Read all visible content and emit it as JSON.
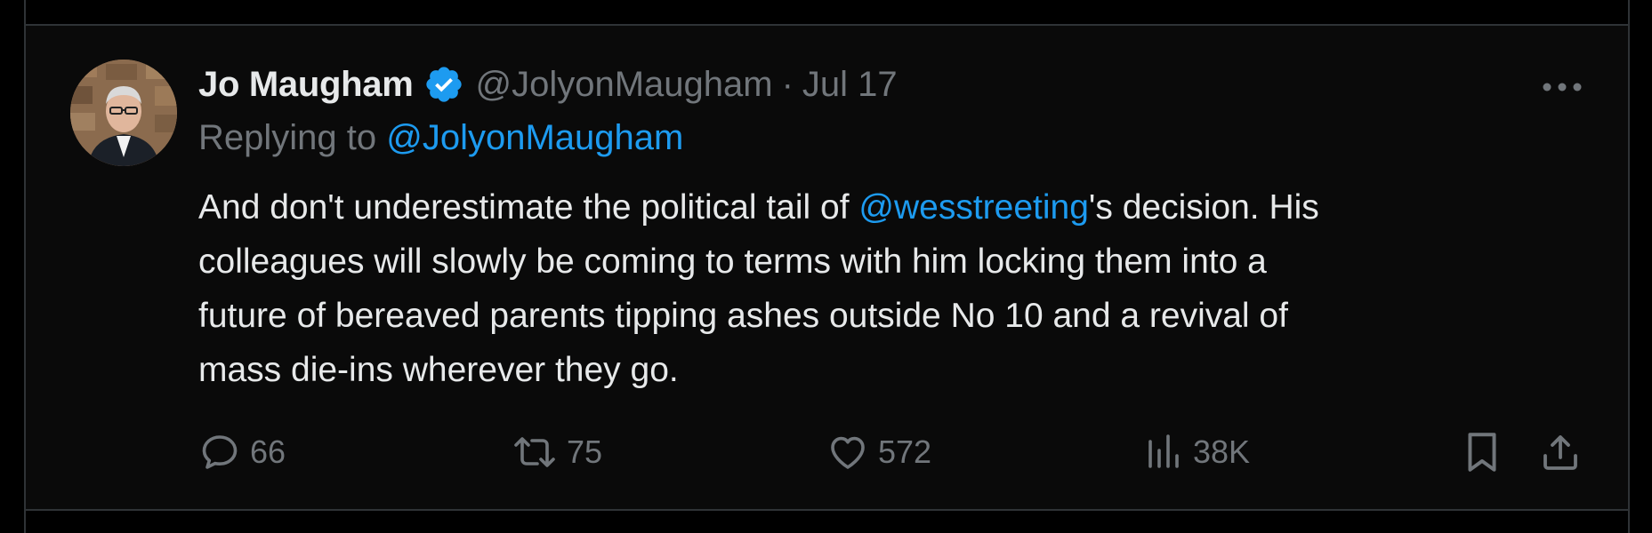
{
  "author": {
    "display_name": "Jo Maugham",
    "handle": "@JolyonMaugham",
    "separator": "·",
    "date": "Jul 17"
  },
  "reply": {
    "prefix": "Replying to ",
    "mention": "@JolyonMaugham"
  },
  "tweet": {
    "line1_before": "And don't underestimate the political tail of ",
    "line1_mention": "@wesstreeting",
    "line1_after": "'s decision. His",
    "line2": "colleagues will slowly be coming to terms with him locking them into a",
    "line3": "future of bereaved parents tipping ashes outside No 10 and a revival of",
    "line4": "mass die-ins wherever they go."
  },
  "actions": {
    "replies": "66",
    "retweets": "75",
    "likes": "572",
    "views": "38K"
  },
  "icons": {
    "verified": "verified-badge-icon",
    "more": "more-horizontal-icon",
    "reply": "reply-bubble-icon",
    "retweet": "retweet-icon",
    "like": "heart-icon",
    "views": "analytics-bars-icon",
    "bookmark": "bookmark-icon",
    "share": "share-upload-icon"
  },
  "colors": {
    "background": "#000000",
    "card": "#0a0a0a",
    "text": "#e7e9ea",
    "muted": "#71767b",
    "accent": "#1d9bf0",
    "border": "#2f3336"
  }
}
